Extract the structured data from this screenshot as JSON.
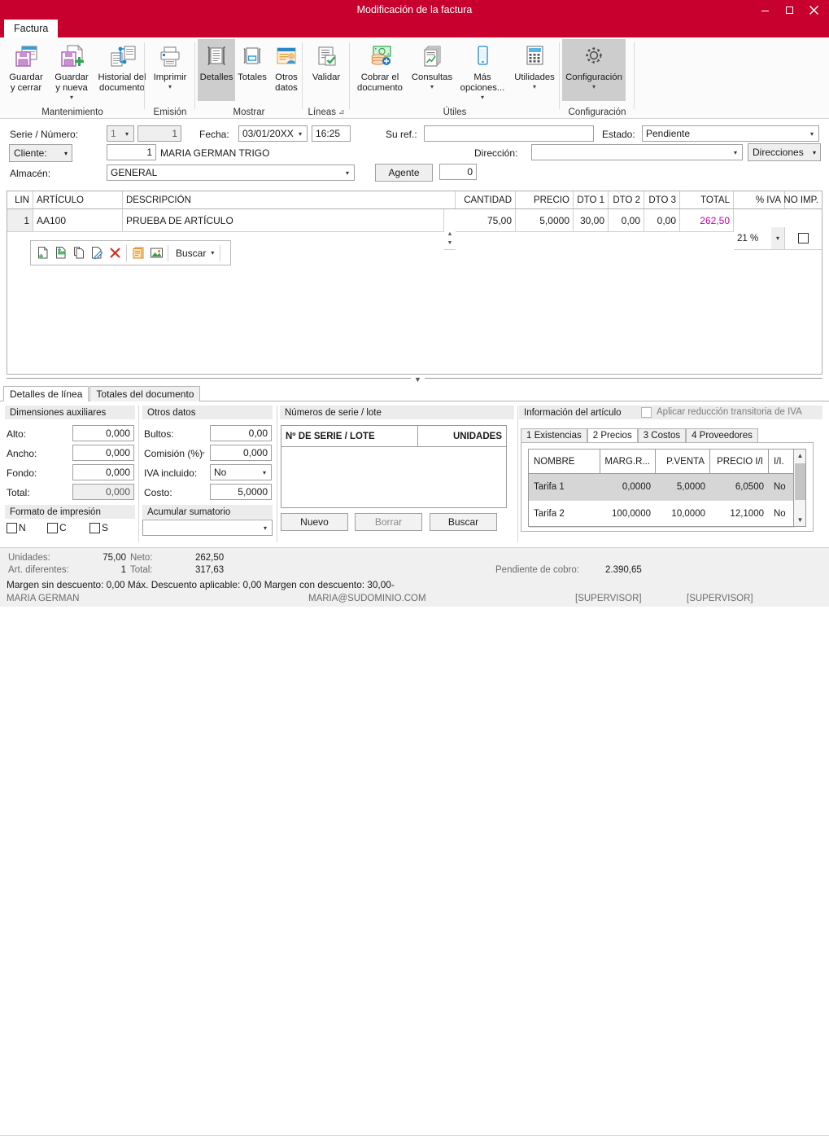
{
  "window": {
    "title": "Modificación de la factura",
    "minimize": "minimize-icon",
    "maximize": "maximize-icon",
    "close": "close-icon"
  },
  "ribbon": {
    "tab": "Factura",
    "groups": [
      {
        "name": "Mantenimiento",
        "buttons": [
          {
            "label": "Guardar\ny cerrar",
            "icon": "save-close-icon",
            "caret": ""
          },
          {
            "label": "Guardar\ny nueva",
            "icon": "save-new-icon",
            "caret": "▾"
          },
          {
            "label": "Historial del\ndocumento",
            "icon": "document-history-icon",
            "caret": ""
          }
        ]
      },
      {
        "name": "Emisión",
        "buttons": [
          {
            "label": "Imprimir",
            "icon": "printer-icon",
            "caret": "▾"
          }
        ]
      },
      {
        "name": "Mostrar",
        "buttons": [
          {
            "label": "Detalles",
            "icon": "details-icon",
            "caret": "",
            "active": true
          },
          {
            "label": "Totales",
            "icon": "totals-icon",
            "caret": ""
          },
          {
            "label": "Otros\ndatos",
            "icon": "other-data-icon",
            "caret": ""
          }
        ]
      },
      {
        "name": "Líneas",
        "launcher": "⊿",
        "buttons": [
          {
            "label": "Validar",
            "icon": "validate-icon",
            "caret": ""
          }
        ]
      },
      {
        "name": "Útiles",
        "buttons": [
          {
            "label": "Cobrar el\ndocumento",
            "icon": "money-collect-icon",
            "caret": ""
          },
          {
            "label": "Consultas",
            "icon": "queries-icon",
            "caret": "▾"
          },
          {
            "label": "Más\nopciones...",
            "icon": "more-options-icon",
            "caret": "▾"
          },
          {
            "label": "Utilidades",
            "icon": "calculator-icon",
            "caret": "▾"
          }
        ]
      },
      {
        "name": "Configuración",
        "buttons": [
          {
            "label": "Configuración",
            "icon": "gear-icon",
            "caret": "▾",
            "active": true
          }
        ]
      }
    ]
  },
  "header": {
    "serie_label": "Serie / Número:",
    "serie_value": "1",
    "numero_value": "1",
    "fecha_label": "Fecha:",
    "fecha_value": "03/01/20XX",
    "hora_value": "16:25",
    "suref_label": "Su ref.:",
    "suref_value": "",
    "estado_label": "Estado:",
    "estado_value": "Pendiente",
    "cliente_label": "Cliente:",
    "cliente_code": "1",
    "cliente_name": "MARIA GERMAN TRIGO",
    "direccion_label": "Dirección:",
    "direccion_value": "",
    "direcciones_button": "Direcciones",
    "almacen_label": "Almacén:",
    "almacen_value": "GENERAL",
    "agente_button": "Agente",
    "agente_value": "0"
  },
  "lines_grid": {
    "columns": [
      "LIN",
      "ARTÍCULO",
      "DESCRIPCIÓN",
      "CANTIDAD",
      "PRECIO",
      "DTO 1",
      "DTO 2",
      "DTO 3",
      "TOTAL",
      "% IVA",
      "NO IMP."
    ],
    "rows": [
      {
        "lin": "1",
        "articulo": "AA100",
        "descripcion": "PRUEBA DE ARTÍCULO",
        "cantidad": "75,00",
        "precio": "5,0000",
        "dto1": "30,00",
        "dto2": "0,00",
        "dto3": "0,00",
        "total": "262,50",
        "iva": "21 %",
        "no_imp": false
      }
    ]
  },
  "line_toolbar": {
    "icons": [
      "new-line-icon",
      "insert-line-icon",
      "copy-line-icon",
      "edit-line-icon",
      "delete-line-icon",
      "notes-icon",
      "image-icon"
    ],
    "buscar_label": "Buscar",
    "buscar_caret": "▾"
  },
  "bottom_tabs": [
    {
      "label": "Detalles de línea",
      "selected": true
    },
    {
      "label": "Totales del documento",
      "selected": false
    }
  ],
  "dimensions_panel": {
    "title": "Dimensiones auxiliares",
    "fields": [
      {
        "label": "Alto:",
        "value": "0,000",
        "readonly": false
      },
      {
        "label": "Ancho:",
        "value": "0,000",
        "readonly": false
      },
      {
        "label": "Fondo:",
        "value": "0,000",
        "readonly": false
      },
      {
        "label": "Total:",
        "value": "0,000",
        "readonly": true
      }
    ],
    "print_format_title": "Formato de impresión",
    "print_checks": [
      {
        "label": "N",
        "checked": false
      },
      {
        "label": "C",
        "checked": false
      },
      {
        "label": "S",
        "checked": false
      }
    ]
  },
  "other_data_panel": {
    "title": "Otros datos",
    "bultos_label": "Bultos:",
    "bultos_value": "0,00",
    "comision_label": "Comisión (%)",
    "comision_value": "0,000",
    "iva_incluido_label": "IVA incluido:",
    "iva_incluido_value": "No",
    "costo_label": "Costo:",
    "costo_value": "5,0000",
    "acumular_title": "Acumular sumatorio",
    "acumular_value": ""
  },
  "serial_panel": {
    "title": "Números de serie / lote",
    "columns": [
      "Nº DE SERIE / LOTE",
      "UNIDADES"
    ],
    "rows": [],
    "buttons": [
      {
        "label": "Nuevo",
        "enabled": true
      },
      {
        "label": "Borrar",
        "enabled": false
      },
      {
        "label": "Buscar",
        "enabled": true
      }
    ]
  },
  "article_info": {
    "title": "Información del artículo",
    "reduction_checkbox_label": "Aplicar reducción transitoria de IVA",
    "reduction_checked": false,
    "tabs": [
      {
        "label": "1 Existencias",
        "selected": false
      },
      {
        "label": "2 Precios",
        "selected": true
      },
      {
        "label": "3 Costos",
        "selected": false
      },
      {
        "label": "4 Proveedores",
        "selected": false
      }
    ],
    "price_table": {
      "columns": [
        "NOMBRE",
        "MARG.R...",
        "P.VENTA",
        "PRECIO I/I",
        "I/I."
      ],
      "rows": [
        {
          "nombre": "Tarifa 1",
          "margen": "0,0000",
          "pventa": "5,0000",
          "precio_ii": "6,0500",
          "ii": "No",
          "selected": true
        },
        {
          "nombre": "Tarifa 2",
          "margen": "100,0000",
          "pventa": "10,0000",
          "precio_ii": "12,1000",
          "ii": "No",
          "selected": false
        }
      ]
    }
  },
  "status_bar": {
    "unidades_label": "Unidades:",
    "unidades_value": "75,00",
    "neto_label": "Neto:",
    "neto_value": "262,50",
    "art_dif_label": "Art. diferentes:",
    "art_dif_value": "1",
    "total_label": "Total:",
    "total_value": "317,63",
    "margen_line": "Margen sin descuento: 0,00  Máx. Descuento aplicable: 0,00  Margen con descuento: 30,00-",
    "pendiente_label": "Pendiente de cobro:",
    "pendiente_value": "2.390,65",
    "user_name": "MARIA GERMAN",
    "user_email": "MARIA@SUDOMINIO.COM",
    "supervisor1": "[SUPERVISOR]",
    "supervisor2": "[SUPERVISOR]"
  },
  "colors": {
    "accent_red": "#C8002E",
    "total_magenta": "#C000A0",
    "ribbon_bg": "#FBFBFB",
    "status_bg": "#F0F0F0"
  }
}
